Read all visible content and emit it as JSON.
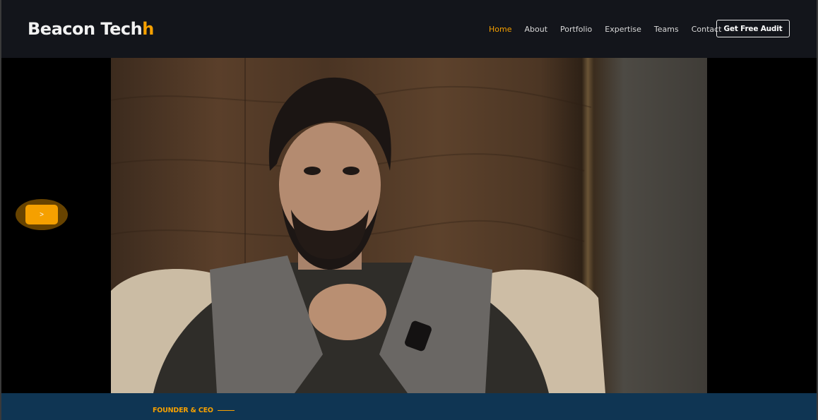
{
  "brand": {
    "name": "Beacon Tech",
    "accent_letter": "h",
    "accent_color": "#f5a000"
  },
  "nav": {
    "items": [
      {
        "label": "Home",
        "active": true
      },
      {
        "label": "About",
        "active": false
      },
      {
        "label": "Portfolio",
        "active": false
      },
      {
        "label": "Expertise",
        "active": false
      },
      {
        "label": "Teams",
        "active": false
      },
      {
        "label": "Contact",
        "active": false
      }
    ],
    "cta_label": "Get Free Audit"
  },
  "video": {
    "play_icon": ">",
    "play_icon_name": "play-icon"
  },
  "founder": {
    "label": "FOUNDER & CEO"
  },
  "colors": {
    "header_bg": "#13151b",
    "band_bg": "#0f3553",
    "accent": "#f5a000"
  }
}
